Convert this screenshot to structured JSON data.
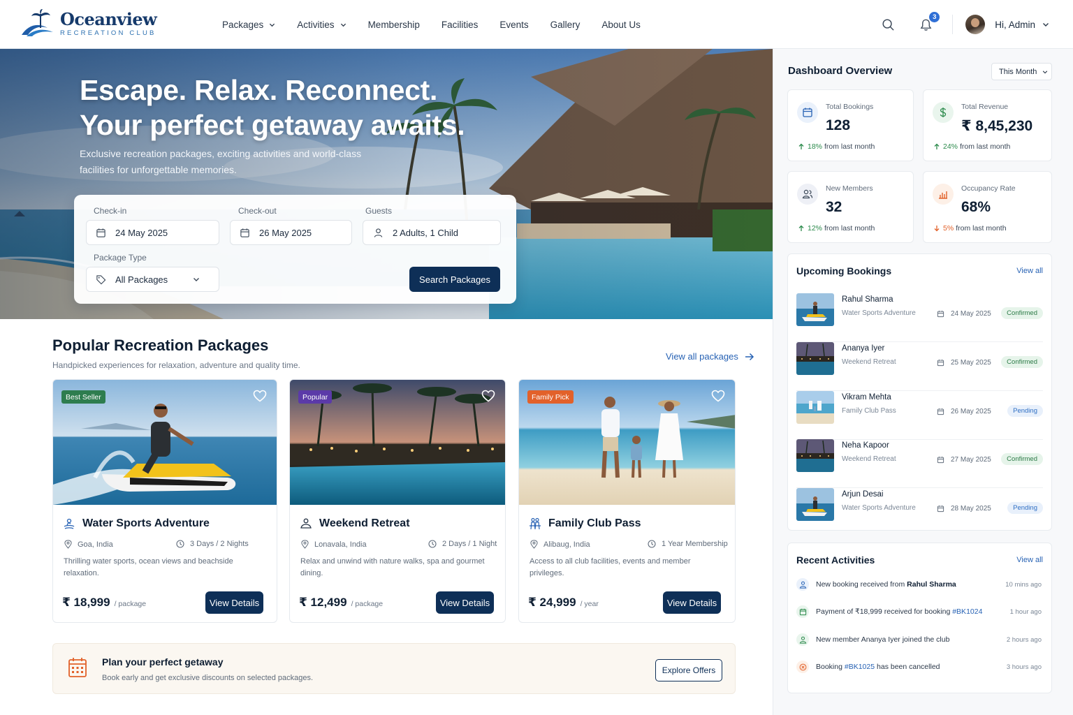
{
  "brand": {
    "name": "Oceanview",
    "tagline": "RECREATION CLUB"
  },
  "nav": {
    "items": [
      {
        "label": "Packages",
        "dropdown": true
      },
      {
        "label": "Activities",
        "dropdown": true
      },
      {
        "label": "Membership",
        "dropdown": false
      },
      {
        "label": "Facilities",
        "dropdown": false
      },
      {
        "label": "Events",
        "dropdown": false
      },
      {
        "label": "Gallery",
        "dropdown": false
      },
      {
        "label": "About Us",
        "dropdown": false
      }
    ],
    "notification_count": "3",
    "user_greeting": "Hi, Admin"
  },
  "hero": {
    "title_line1": "Escape. Relax. Reconnect.",
    "title_line2": "Your perfect getaway awaits.",
    "subtitle": "Exclusive recreation packages, exciting activities and world-class facilities for unforgettable memories.",
    "search": {
      "checkin_label": "Check-in",
      "checkin_value": "24 May 2025",
      "checkout_label": "Check-out",
      "checkout_value": "26 May 2025",
      "guests_label": "Guests",
      "guests_value": "2 Adults, 1 Child",
      "package_type_label": "Package Type",
      "package_type_value": "All Packages",
      "search_button": "Search Packages"
    }
  },
  "packages": {
    "title": "Popular Recreation Packages",
    "subtitle": "Handpicked experiences for relaxation, adventure and quality time.",
    "view_all": "View all packages",
    "items": [
      {
        "tag": "Best Seller",
        "tag_color": "#2e7d4f",
        "title": "Water Sports Adventure",
        "location": "Goa, India",
        "duration": "3 Days / 2 Nights",
        "description": "Thrilling water sports, ocean views and beachside relaxation.",
        "price": "₹ 18,999",
        "unit": "/ package",
        "button": "View Details",
        "icon": "jetski-icon"
      },
      {
        "tag": "Popular",
        "tag_color": "#5b3aa8",
        "title": "Weekend Retreat",
        "location": "Lonavala, India",
        "duration": "2 Days / 1 Night",
        "description": "Relax and unwind with nature walks, spa and gourmet dining.",
        "price": "₹ 12,499",
        "unit": "/ package",
        "button": "View Details",
        "icon": "spa-icon"
      },
      {
        "tag": "Family Pick",
        "tag_color": "#e2612a",
        "title": "Family Club Pass",
        "location": "Alibaug, India",
        "duration": "1 Year Membership",
        "description": "Access to all club facilities, events and member privileges.",
        "price": "₹ 24,999",
        "unit": "/ year",
        "button": "View Details",
        "icon": "family-icon"
      }
    ]
  },
  "plan": {
    "title": "Plan your perfect getaway",
    "subtitle": "Book early and get exclusive discounts on selected packages.",
    "button": "Explore Offers"
  },
  "dashboard": {
    "title": "Dashboard Overview",
    "period": "This Month",
    "stats": [
      {
        "label": "Total Bookings",
        "value": "128",
        "change": "18%",
        "change_text": "from last month",
        "direction": "up"
      },
      {
        "label": "Total Revenue",
        "value": "₹ 8,45,230",
        "change": "24%",
        "change_text": "from last month",
        "direction": "up"
      },
      {
        "label": "New Members",
        "value": "32",
        "change": "12%",
        "change_text": "from last month",
        "direction": "up"
      },
      {
        "label": "Occupancy Rate",
        "value": "68%",
        "change": "5%",
        "change_text": "from last month",
        "direction": "down"
      }
    ],
    "colors": {
      "up": "#2b8a4b",
      "down": "#e2612a",
      "accent": "#0e2f57",
      "link": "#2762b4"
    }
  },
  "bookings": {
    "title": "Upcoming Bookings",
    "view_all": "View all",
    "items": [
      {
        "name": "Rahul Sharma",
        "package": "Water Sports Adventure",
        "date": "24 May 2025",
        "status": "Confirmed",
        "thumb": "jetski"
      },
      {
        "name": "Ananya Iyer",
        "package": "Weekend Retreat",
        "date": "25 May 2025",
        "status": "Confirmed",
        "thumb": "resort"
      },
      {
        "name": "Vikram Mehta",
        "package": "Family Club Pass",
        "date": "26 May 2025",
        "status": "Pending",
        "thumb": "beach"
      },
      {
        "name": "Neha Kapoor",
        "package": "Weekend Retreat",
        "date": "27 May 2025",
        "status": "Confirmed",
        "thumb": "resort"
      },
      {
        "name": "Arjun Desai",
        "package": "Water Sports Adventure",
        "date": "28 May 2025",
        "status": "Pending",
        "thumb": "jetski"
      }
    ]
  },
  "activities": {
    "title": "Recent Activities",
    "view_all": "View all",
    "items": [
      {
        "pre": "New booking received from ",
        "bold": "Rahul Sharma",
        "link": "",
        "post": "",
        "time": "10 mins ago",
        "icon": "user-icon"
      },
      {
        "pre": "Payment of ₹18,999 received for booking ",
        "bold": "",
        "link": "#BK1024",
        "post": "",
        "time": "1 hour ago",
        "icon": "payment-icon"
      },
      {
        "pre": "New member Ananya Iyer joined the club",
        "bold": "",
        "link": "",
        "post": "",
        "time": "2 hours ago",
        "icon": "member-icon"
      },
      {
        "pre": "Booking ",
        "bold": "",
        "link": "#BK1025",
        "post": " has been cancelled",
        "time": "3 hours ago",
        "icon": "cancel-icon"
      }
    ]
  }
}
